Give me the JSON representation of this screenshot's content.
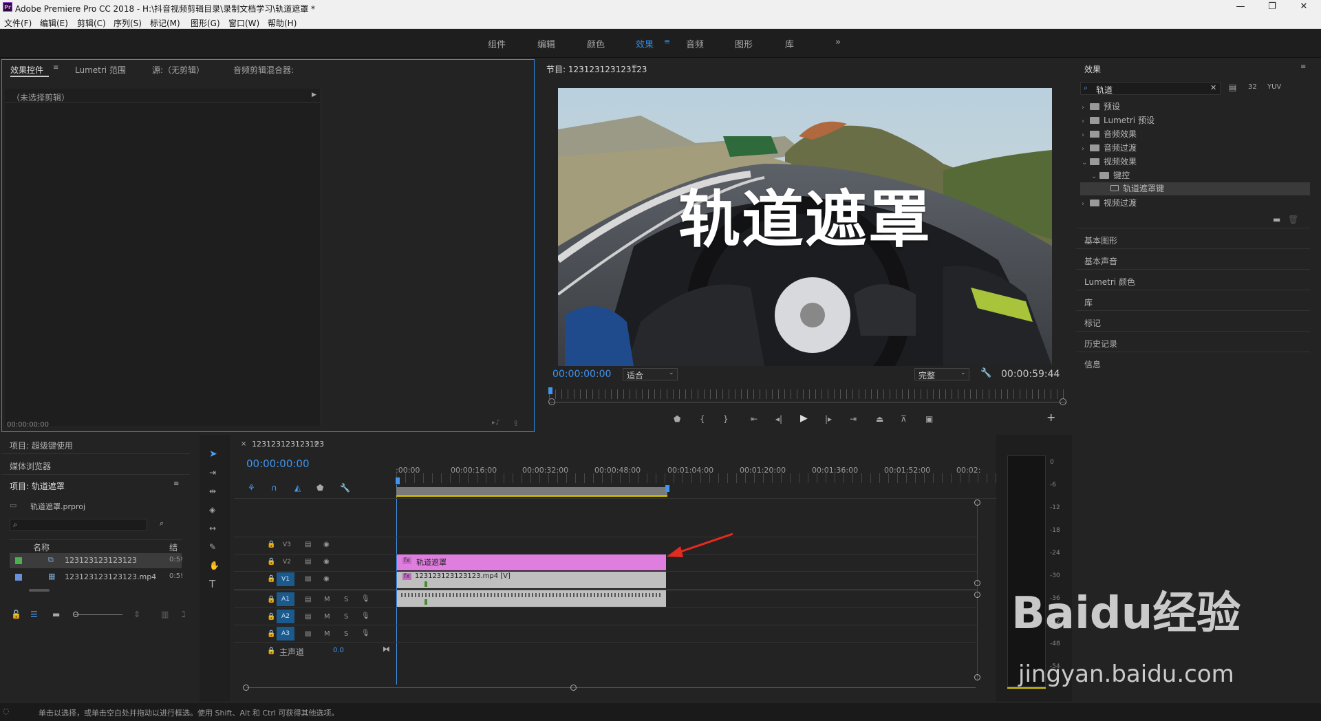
{
  "window": {
    "title": "Adobe Premiere Pro CC 2018 - H:\\抖音视频剪辑目录\\录制文档学习\\轨道遮罩 *"
  },
  "menu": [
    "文件(F)",
    "编辑(E)",
    "剪辑(C)",
    "序列(S)",
    "标记(M)",
    "图形(G)",
    "窗口(W)",
    "帮助(H)"
  ],
  "workspaces": [
    "组件",
    "编辑",
    "颜色",
    "效果",
    "音频",
    "图形",
    "库"
  ],
  "workspace_active": "效果",
  "workspace_more": "»",
  "source_panel": {
    "tabs": [
      "效果控件",
      "Lumetri 范围",
      "源:（无剪辑）",
      "音频剪辑混合器:"
    ],
    "no_clip": "（未选择剪辑）",
    "timecode": "00:00:00:00"
  },
  "program": {
    "title": "节目: 123123123123123",
    "overlay_text": "轨道遮罩",
    "timecode": "00:00:00:00",
    "fit": "适合",
    "quality": "完整",
    "duration": "00:00:59:44"
  },
  "effects_panel": {
    "title": "效果",
    "search": "轨道",
    "tree": [
      {
        "label": "预设",
        "level": 0
      },
      {
        "label": "Lumetri 预设",
        "level": 0
      },
      {
        "label": "音频效果",
        "level": 0
      },
      {
        "label": "音频过渡",
        "level": 0
      },
      {
        "label": "视频效果",
        "level": 0,
        "open": true
      },
      {
        "label": "键控",
        "level": 1,
        "open": true
      },
      {
        "label": "轨道遮罩键",
        "level": 2,
        "selected": true
      },
      {
        "label": "视频过渡",
        "level": 0
      }
    ],
    "sections": [
      "基本图形",
      "基本声音",
      "Lumetri 颜色",
      "库",
      "标记",
      "历史记录",
      "信息"
    ]
  },
  "project": {
    "tabs": [
      "项目: 超级键使用",
      "媒体浏览器"
    ],
    "title": "项目: 轨道遮罩",
    "file": "轨道遮罩.prproj",
    "col_name": "名称",
    "col_rate": "结",
    "items": [
      {
        "name": "123123123123123",
        "dur": "0:5!",
        "color": "#4caf50"
      },
      {
        "name": "123123123123123.mp4",
        "dur": "0:5!",
        "color": "#6a8fd6"
      }
    ]
  },
  "timeline": {
    "tab": "123123123123123",
    "timecode": "00:00:00:00",
    "ruler": [
      ":00:00",
      "00:00:16:00",
      "00:00:32:00",
      "00:00:48:00",
      "00:01:04:00",
      "00:01:20:00",
      "00:01:36:00",
      "00:01:52:00",
      "00:02:"
    ],
    "video_tracks": [
      "V3",
      "V2",
      "V1"
    ],
    "audio_tracks": [
      "A1",
      "A2",
      "A3"
    ],
    "master": "主声道",
    "master_val": "0.0",
    "clip_v2": "轨道遮罩",
    "clip_v1": "123123123123123.mp4 [V]",
    "fx": "fx"
  },
  "meter_scale": [
    "0",
    "-6",
    "-12",
    "-18",
    "-24",
    "-30",
    "-36",
    "-42",
    "-48",
    "-54"
  ],
  "status": "单击以选择，或单击空白处并拖动以进行框选。使用 Shift、Alt 和 Ctrl 可获得其他选项。",
  "watermark": {
    "brand": "Baidu经验",
    "url": "jingyan.baidu.com"
  }
}
